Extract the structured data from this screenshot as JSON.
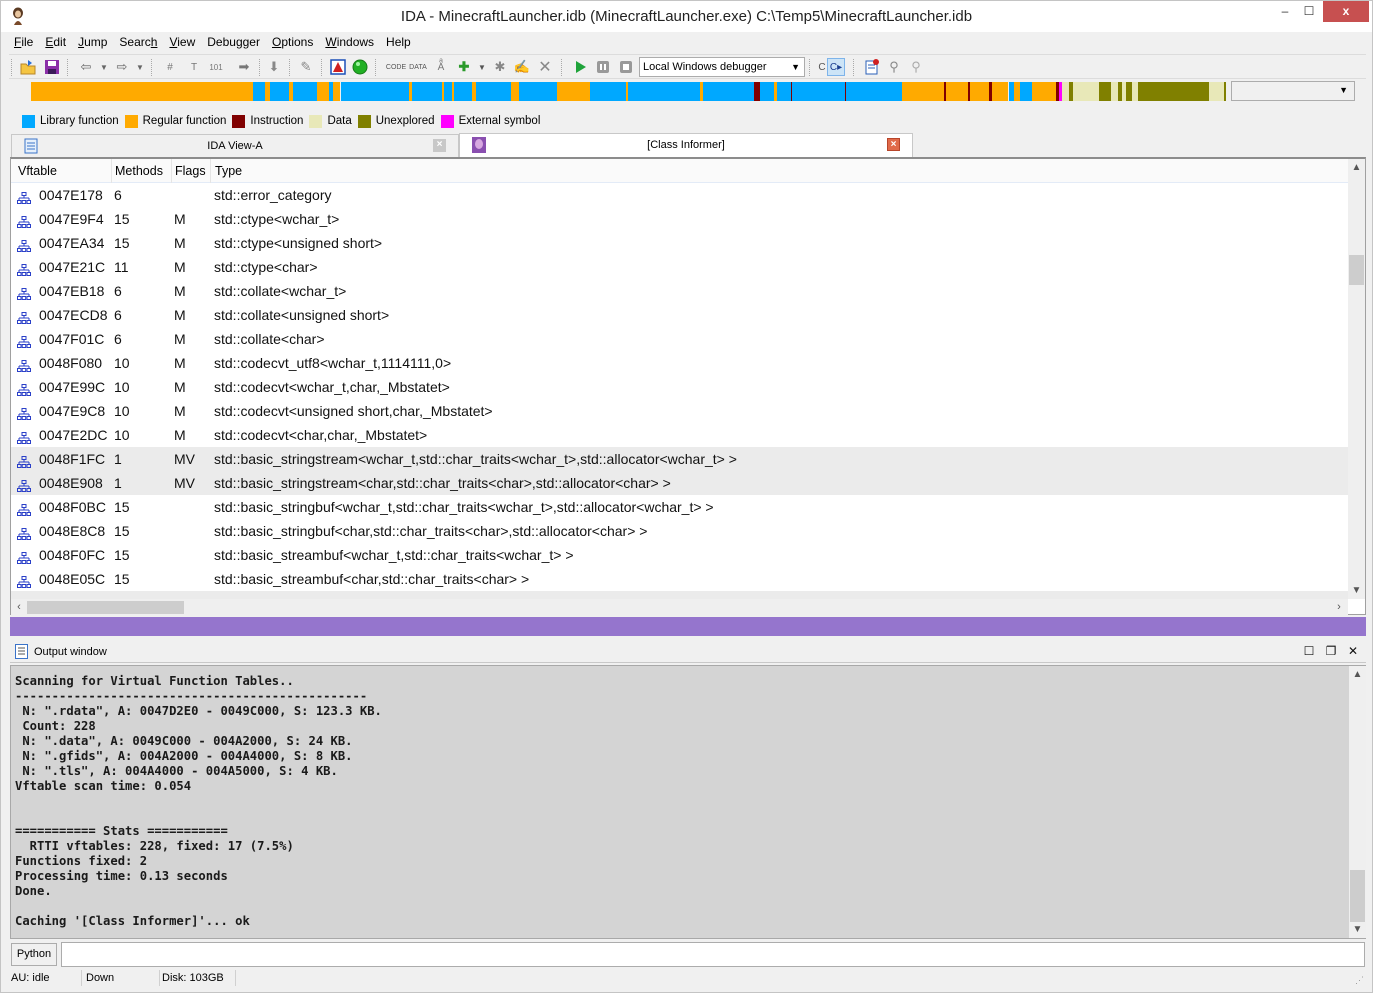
{
  "window": {
    "title": "IDA - MinecraftLauncher.idb (MinecraftLauncher.exe) C:\\Temp5\\MinecraftLauncher.idb",
    "controls": {
      "minimize": "‒",
      "maximize": "☐",
      "close": "x"
    }
  },
  "menu": [
    {
      "label": "File",
      "underline": "F",
      "rest": "ile"
    },
    {
      "label": "Edit",
      "underline": "E",
      "rest": "dit"
    },
    {
      "label": "Jump",
      "underline": "J",
      "rest": "ump"
    },
    {
      "label": "Search",
      "pre": "Searc",
      "underline": "h",
      "rest": ""
    },
    {
      "label": "View",
      "underline": "V",
      "rest": "iew"
    },
    {
      "label": "Debugger",
      "underline": "",
      "rest": "Debugger"
    },
    {
      "label": "Options",
      "underline": "O",
      "rest": "ptions"
    },
    {
      "label": "Windows",
      "underline": "W",
      "rest": "indows"
    },
    {
      "label": "Help",
      "underline": "",
      "rest": "Help"
    }
  ],
  "toolbar": {
    "debugger_select": "Local Windows debugger",
    "icons": [
      "open-icon",
      "save-icon",
      "back-icon",
      "forward-icon",
      "search-binary-icon",
      "search-text-icon",
      "search-immediate-icon",
      "search-next-icon",
      "jump-down-icon",
      "wrench-icon",
      "warning-icon",
      "green-circle-icon",
      "make-code-icon",
      "make-data-icon",
      "make-ascii-icon",
      "make-struct-icon",
      "make-array-icon",
      "rename-icon",
      "undefine-icon",
      "run-icon",
      "pause-icon",
      "stop-icon",
      "step-into-icon",
      "step-over-icon",
      "breakpoint-list-icon",
      "add-breakpoint-icon",
      "delete-breakpoint-icon"
    ]
  },
  "navband": {
    "colors": {
      "library": "#00a8ff",
      "regular": "#ffaa00",
      "instruction": "#800000",
      "data": "#e8e8b8",
      "unexplored": "#808000",
      "external": "#ff00ff"
    },
    "segments": [
      [
        "regular",
        0,
        0.186
      ],
      [
        "library",
        0.186,
        0.01
      ],
      [
        "regular",
        0.196,
        0.004
      ],
      [
        "library",
        0.2,
        0.016
      ],
      [
        "regular",
        0.216,
        0.003
      ],
      [
        "library",
        0.219,
        0.02
      ],
      [
        "regular",
        0.239,
        0.01
      ],
      [
        "library",
        0.249,
        0.004
      ],
      [
        "regular",
        0.253,
        0.006
      ],
      [
        "library",
        0.259,
        0.057
      ],
      [
        "regular",
        0.316,
        0.003
      ],
      [
        "library",
        0.319,
        0.025
      ],
      [
        "regular",
        0.344,
        0.002
      ],
      [
        "library",
        0.346,
        0.006
      ],
      [
        "regular",
        0.352,
        0.002
      ],
      [
        "library",
        0.354,
        0.015
      ],
      [
        "regular",
        0.369,
        0.003
      ],
      [
        "library",
        0.372,
        0.03
      ],
      [
        "regular",
        0.402,
        0.006
      ],
      [
        "library",
        0.408,
        0.032
      ],
      [
        "regular",
        0.44,
        0.028
      ],
      [
        "library",
        0.468,
        0.2
      ],
      [
        "regular",
        0.498,
        0.002
      ],
      [
        "library",
        0.5,
        0.06
      ],
      [
        "regular",
        0.56,
        0.002
      ],
      [
        "library",
        0.562,
        0.043
      ],
      [
        "instruction",
        0.605,
        0.005
      ],
      [
        "library",
        0.61,
        0.012
      ],
      [
        "regular",
        0.622,
        0.002
      ],
      [
        "library",
        0.624,
        0.012
      ],
      [
        "instruction",
        0.636,
        0.001
      ],
      [
        "library",
        0.637,
        0.044
      ],
      [
        "instruction",
        0.681,
        0.001
      ],
      [
        "library",
        0.682,
        0.047
      ],
      [
        "regular",
        0.729,
        0.035
      ],
      [
        "instruction",
        0.764,
        0.002
      ],
      [
        "regular",
        0.766,
        0.018
      ],
      [
        "instruction",
        0.784,
        0.002
      ],
      [
        "regular",
        0.786,
        0.016
      ],
      [
        "instruction",
        0.802,
        0.002
      ],
      [
        "regular",
        0.804,
        0.014
      ],
      [
        "library",
        0.818,
        0.005
      ],
      [
        "regular",
        0.823,
        0.005
      ],
      [
        "library",
        0.828,
        0.01
      ],
      [
        "regular",
        0.838,
        0.02
      ],
      [
        "instruction",
        0.858,
        0.002
      ],
      [
        "external",
        0.86,
        0.003
      ],
      [
        "data",
        0.863,
        0.006
      ],
      [
        "unexplored",
        0.869,
        0.003
      ],
      [
        "data",
        0.872,
        0.022
      ],
      [
        "unexplored",
        0.894,
        0.01
      ],
      [
        "data",
        0.904,
        0.006
      ],
      [
        "unexplored",
        0.91,
        0.003
      ],
      [
        "data",
        0.913,
        0.003
      ],
      [
        "unexplored",
        0.916,
        0.005
      ],
      [
        "data",
        0.921,
        0.005
      ],
      [
        "unexplored",
        0.926,
        0.06
      ],
      [
        "data",
        0.986,
        0.012
      ],
      [
        "unexplored",
        0.998,
        0.002
      ]
    ]
  },
  "legend": [
    {
      "label": "Library function",
      "color": "#00a8ff"
    },
    {
      "label": "Regular function",
      "color": "#ffaa00"
    },
    {
      "label": "Instruction",
      "color": "#800000"
    },
    {
      "label": "Data",
      "color": "#e8e8b8"
    },
    {
      "label": "Unexplored",
      "color": "#808000"
    },
    {
      "label": "External symbol",
      "color": "#ff00ff"
    }
  ],
  "tabs": [
    {
      "label": "IDA View-A",
      "active": false
    },
    {
      "label": "[Class Informer]",
      "active": true
    }
  ],
  "class_informer": {
    "columns": [
      "Vftable",
      "Methods",
      "Flags",
      "Type"
    ],
    "rows": [
      {
        "vftable": "0047E178",
        "methods": "6",
        "flags": "",
        "type": "std::error_category",
        "selected": false
      },
      {
        "vftable": "0047E9F4",
        "methods": "15",
        "flags": "M",
        "type": "std::ctype<wchar_t>",
        "selected": false
      },
      {
        "vftable": "0047EA34",
        "methods": "15",
        "flags": "M",
        "type": "std::ctype<unsigned short>",
        "selected": false
      },
      {
        "vftable": "0047E21C",
        "methods": "11",
        "flags": "M",
        "type": "std::ctype<char>",
        "selected": false
      },
      {
        "vftable": "0047EB18",
        "methods": "6",
        "flags": "M",
        "type": "std::collate<wchar_t>",
        "selected": false
      },
      {
        "vftable": "0047ECD8",
        "methods": "6",
        "flags": "M",
        "type": "std::collate<unsigned short>",
        "selected": false
      },
      {
        "vftable": "0047F01C",
        "methods": "6",
        "flags": "M",
        "type": "std::collate<char>",
        "selected": false
      },
      {
        "vftable": "0048F080",
        "methods": "10",
        "flags": "M",
        "type": "std::codecvt_utf8<wchar_t,1114111,0>",
        "selected": false
      },
      {
        "vftable": "0047E99C",
        "methods": "10",
        "flags": "M",
        "type": "std::codecvt<wchar_t,char,_Mbstatet>",
        "selected": false
      },
      {
        "vftable": "0047E9C8",
        "methods": "10",
        "flags": "M",
        "type": "std::codecvt<unsigned short,char,_Mbstatet>",
        "selected": false
      },
      {
        "vftable": "0047E2DC",
        "methods": "10",
        "flags": "M",
        "type": "std::codecvt<char,char,_Mbstatet>",
        "selected": false
      },
      {
        "vftable": "0048F1FC",
        "methods": "1",
        "flags": "MV",
        "type": "std::basic_stringstream<wchar_t,std::char_traits<wchar_t>,std::allocator<wchar_t> >",
        "selected": true
      },
      {
        "vftable": "0048E908",
        "methods": "1",
        "flags": "MV",
        "type": "std::basic_stringstream<char,std::char_traits<char>,std::allocator<char> >",
        "selected": true
      },
      {
        "vftable": "0048F0BC",
        "methods": "15",
        "flags": "",
        "type": "std::basic_stringbuf<wchar_t,std::char_traits<wchar_t>,std::allocator<wchar_t> >",
        "selected": false
      },
      {
        "vftable": "0048E8C8",
        "methods": "15",
        "flags": "",
        "type": "std::basic_stringbuf<char,std::char_traits<char>,std::allocator<char> >",
        "selected": false
      },
      {
        "vftable": "0048F0FC",
        "methods": "15",
        "flags": "",
        "type": "std::basic_streambuf<wchar_t,std::char_traits<wchar_t> >",
        "selected": false
      },
      {
        "vftable": "0048E05C",
        "methods": "15",
        "flags": "",
        "type": "std::basic_streambuf<char,std::char_traits<char> >",
        "selected": false
      }
    ]
  },
  "output": {
    "title": "Output window",
    "text": "Scanning for Virtual Function Tables..\n------------------------------------------------\n N: \".rdata\", A: 0047D2E0 - 0049C000, S: 123.3 KB.\n Count: 228\n N: \".data\", A: 0049C000 - 004A2000, S: 24 KB.\n N: \".gfids\", A: 004A2000 - 004A4000, S: 8 KB.\n N: \".tls\", A: 004A4000 - 004A5000, S: 4 KB.\nVftable scan time: 0.054\n\n\n=========== Stats ===========\n  RTTI vftables: 228, fixed: 17 (7.5%)\nFunctions fixed: 2\nProcessing time: 0.13 seconds\nDone.\n\nCaching '[Class Informer]'... ok"
  },
  "command": {
    "language_button": "Python",
    "input_value": ""
  },
  "status": {
    "au": "AU: idle",
    "direction": "Down",
    "disk": "Disk: 103GB"
  }
}
